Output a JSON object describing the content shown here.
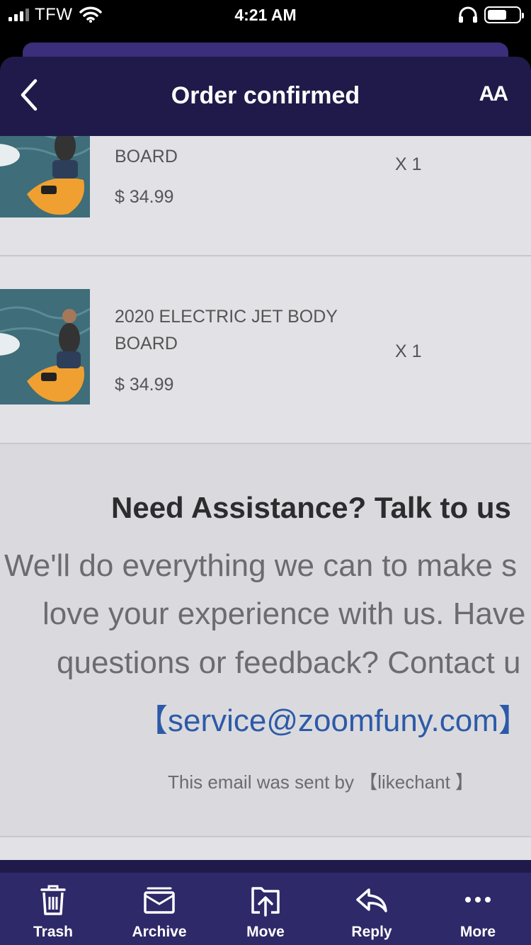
{
  "status_bar": {
    "carrier": "TFW",
    "time": "4:21 AM"
  },
  "header": {
    "title": "Order confirmed",
    "text_size_label": "AA"
  },
  "order_items": [
    {
      "name": "BOARD",
      "price": "$ 34.99",
      "quantity": "X 1"
    },
    {
      "name": "2020 ELECTRIC JET BODY BOARD",
      "price": "$ 34.99",
      "quantity": "X 1"
    }
  ],
  "assistance": {
    "title": "Need Assistance? Talk to us",
    "line1": "We'll do everything we can to make s",
    "line2": "love your experience with us. Have",
    "line3": "questions or feedback? Contact u",
    "email": "【service@zoomfuny.com】",
    "sent_by": "This email was sent by 【likechant 】"
  },
  "toolbar": {
    "trash": "Trash",
    "archive": "Archive",
    "move": "Move",
    "reply": "Reply",
    "more": "More"
  },
  "colors": {
    "header_bg": "#201a4a",
    "toolbar_bg": "#2e2968",
    "content_bg": "#e1e1e6",
    "link": "#2d5aa8"
  }
}
